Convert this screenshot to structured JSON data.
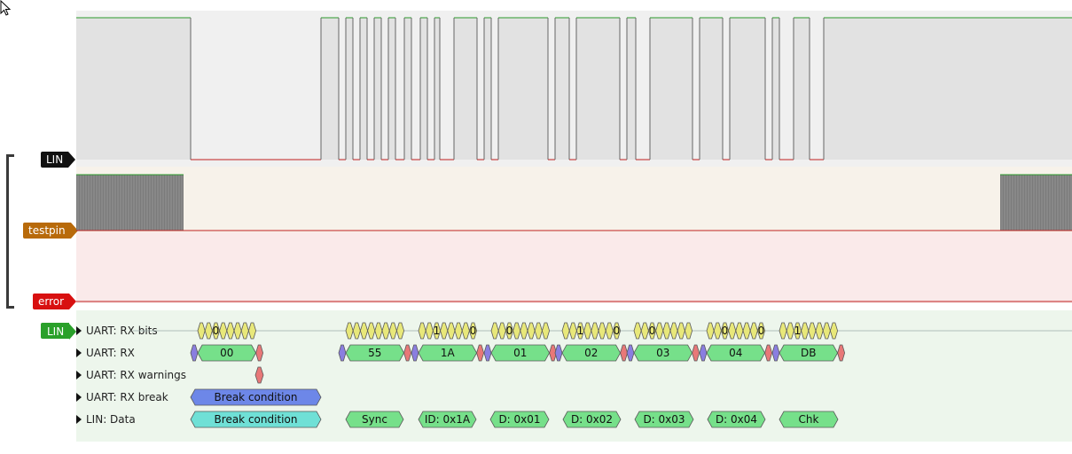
{
  "channels": {
    "lin": "LIN",
    "testpin": "testpin",
    "error": "error",
    "lin_decoder": "LIN"
  },
  "rows": [
    "UART: RX bits",
    "UART: RX",
    "UART: RX warnings",
    "UART: RX break",
    "LIN: Data"
  ],
  "annotations": {
    "rx_bits": [
      {
        "left": "0",
        "right": ""
      },
      {
        "left": "",
        "right": ""
      },
      {
        "left": "1",
        "right": "0"
      },
      {
        "left": "0",
        "right": ""
      },
      {
        "left": "1",
        "right": "0"
      },
      {
        "left": "0",
        "right": ""
      },
      {
        "left": "0",
        "right": "0"
      },
      {
        "left": "1",
        "right": ""
      }
    ],
    "rx": [
      "00",
      "55",
      "1A",
      "01",
      "02",
      "03",
      "04",
      "DB"
    ],
    "rx_break": "Break condition",
    "lin_data": [
      "Break condition",
      "Sync",
      "ID: 0x1A",
      "D: 0x01",
      "D: 0x02",
      "D: 0x03",
      "D: 0x04",
      "Chk"
    ]
  },
  "colors": {
    "signal_high": "#2a9a2a",
    "signal_low": "#c02020",
    "bits": "#e8e87a",
    "rx": "#76e08a",
    "startbit": "#8a7ee0",
    "stopbit": "#e87878",
    "break": "#6d87e8",
    "lin_break": "#6fe0d6",
    "lin_label": "#2aa02a",
    "testpin_label": "#b86a0a",
    "error_label": "#d81010",
    "lin_channel_label": "#111111"
  }
}
